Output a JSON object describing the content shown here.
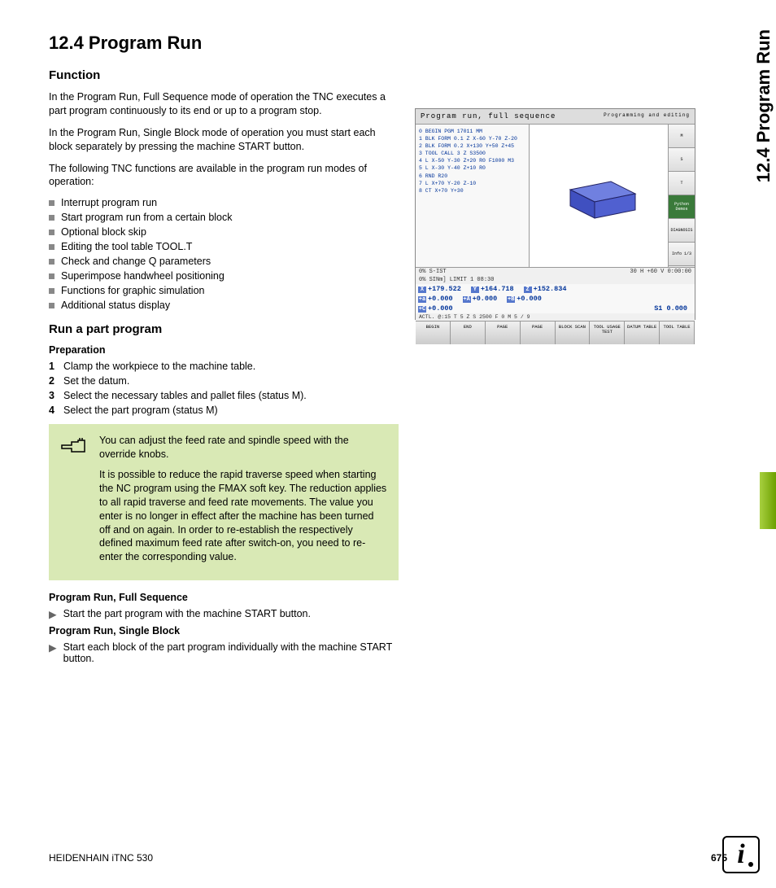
{
  "heading": "12.4  Program Run",
  "side_tab": "12.4 Program Run",
  "sec_function": {
    "title": "Function",
    "p1": "In the Program Run, Full Sequence mode of operation the TNC executes a part program continuously to its end or up to a program stop.",
    "p2": "In the Program Run, Single Block mode of operation you must start each block separately by pressing the machine START button.",
    "p3": "The following TNC functions are available in the program run modes of operation:",
    "bullets": [
      "Interrupt program run",
      "Start program run from a certain block",
      "Optional block skip",
      "Editing the tool table TOOL.T",
      "Check and change Q parameters",
      "Superimpose handwheel positioning",
      "Functions for graphic simulation",
      "Additional status display"
    ]
  },
  "sec_run": {
    "title": "Run a part program",
    "prep_title": "Preparation",
    "steps": [
      "Clamp the workpiece to the machine table.",
      "Set the datum.",
      "Select the necessary tables and pallet files (status M).",
      "Select the part program (status M)"
    ],
    "note1": "You can adjust the feed rate and spindle speed with the override knobs.",
    "note2": "It is possible to reduce the rapid traverse speed when starting the NC program using the FMAX soft key. The reduction applies to all rapid traverse and feed rate movements. The value you enter is no longer in effect after the machine has been turned off and on again. In order to re-establish the respectively defined maximum feed rate after switch-on, you need to re-enter the corresponding value.",
    "full_title": "Program Run, Full Sequence",
    "full_item": "Start the part program with the machine START button.",
    "single_title": "Program Run, Single Block",
    "single_item": "Start each block of the part program individually with the machine START button."
  },
  "screenshot": {
    "title_left": "Program run, full sequence",
    "title_right": "Programming and editing",
    "code": [
      "0  BEGIN PGM 17011 MM",
      "1  BLK FORM 0.1 Z  X-60  Y-70  Z-20",
      "2  BLK FORM 0.2  X+130  Y+50  Z+45",
      "3  TOOL CALL 3 Z S3500",
      "4  L  X-50  Y-30  Z+20 R0 F1000 M3",
      "5  L  X-30  Y-40  Z+10 R0",
      "6  RND R20",
      "7  L  X+70  Y-20  Z-10",
      "8  CT  X+70  Y+30"
    ],
    "status1": "0% S-IST",
    "status2": "0% SINm] LIMIT 1 08:30",
    "status3": "30 H  +60 V     0:00:00",
    "coords_x": "+179.522",
    "coords_y": "+164.718",
    "coords_z": "+152.834",
    "coords_a": "+0.000",
    "coords_A": "+0.000",
    "coords_b": "+0.000",
    "coords_c": "+0.000",
    "s1": "S1   0.000",
    "bottom": "ACTL.      @:15      T 5        Z S 2500      F 0      M 5 / 9",
    "softkeys": [
      "BEGIN",
      "END",
      "PAGE",
      "PAGE",
      "BLOCK SCAN",
      "TOOL USAGE TEST",
      "DATUM TABLE",
      "TOOL TABLE"
    ],
    "side": [
      "M",
      "S",
      "T",
      "Python Demos",
      "DIAGNOSIS",
      "Info 1/3"
    ]
  },
  "footer_left": "HEIDENHAIN iTNC 530",
  "footer_page": "675"
}
